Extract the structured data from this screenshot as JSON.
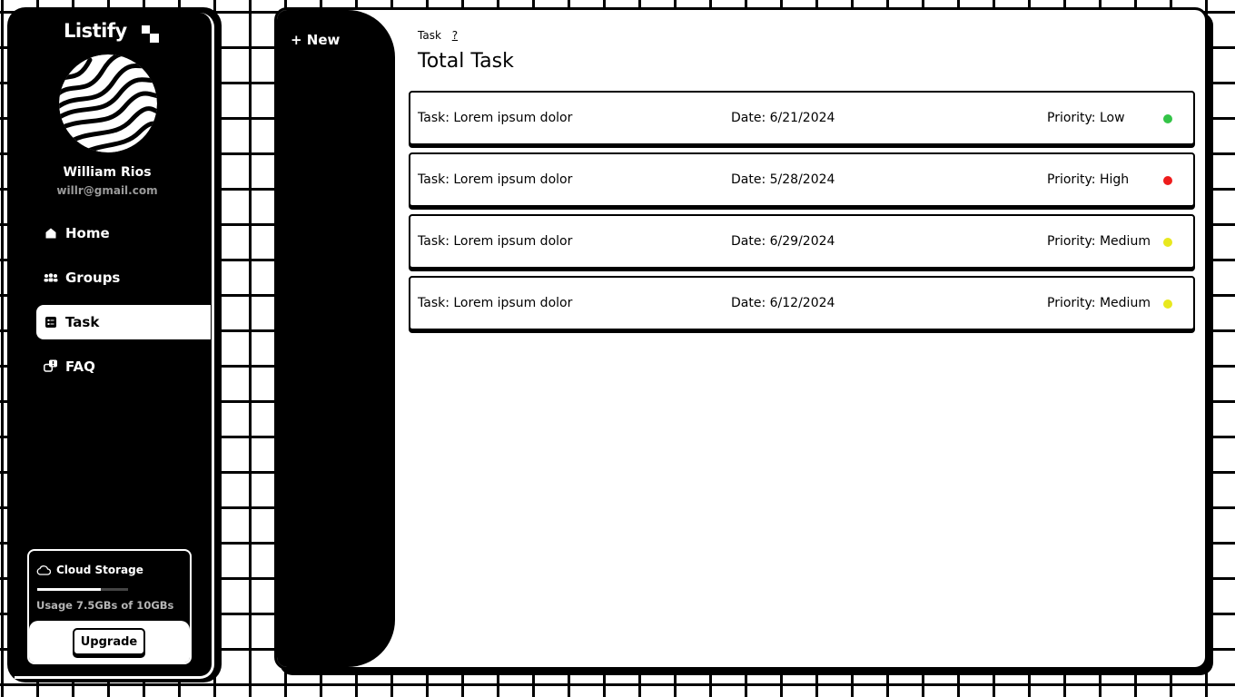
{
  "app": {
    "brand": "Listify"
  },
  "user": {
    "name": "William Rios",
    "email": "willr@gmail.com"
  },
  "sidebar": {
    "items": [
      {
        "label": "Home",
        "icon": "home-icon",
        "active": false
      },
      {
        "label": "Groups",
        "icon": "groups-icon",
        "active": false
      },
      {
        "label": "Task",
        "icon": "task-icon",
        "active": true
      },
      {
        "label": "FAQ",
        "icon": "faq-icon",
        "active": false
      }
    ]
  },
  "storage": {
    "title": "Cloud Storage",
    "usage_text": "Usage 7.5GBs of 10GBs",
    "used_fraction": 0.7,
    "upgrade_label": "Upgrade"
  },
  "main": {
    "new_label": "+ New",
    "breadcrumb": "Task",
    "help_label": "?",
    "title": "Total Task",
    "tasks": [
      {
        "task": "Task: Lorem ipsum dolor",
        "date": "Date: 6/21/2024",
        "priority": "Priority: Low",
        "color": "#33c447"
      },
      {
        "task": "Task: Lorem ipsum dolor",
        "date": "Date: 5/28/2024",
        "priority": "Priority: High",
        "color": "#ee1c1c"
      },
      {
        "task": "Task: Lorem ipsum dolor",
        "date": "Date: 6/29/2024",
        "priority": "Priority: Medium",
        "color": "#e8e81e"
      },
      {
        "task": "Task: Lorem ipsum dolor",
        "date": "Date: 6/12/2024",
        "priority": "Priority: Medium",
        "color": "#e8e81e"
      }
    ]
  }
}
